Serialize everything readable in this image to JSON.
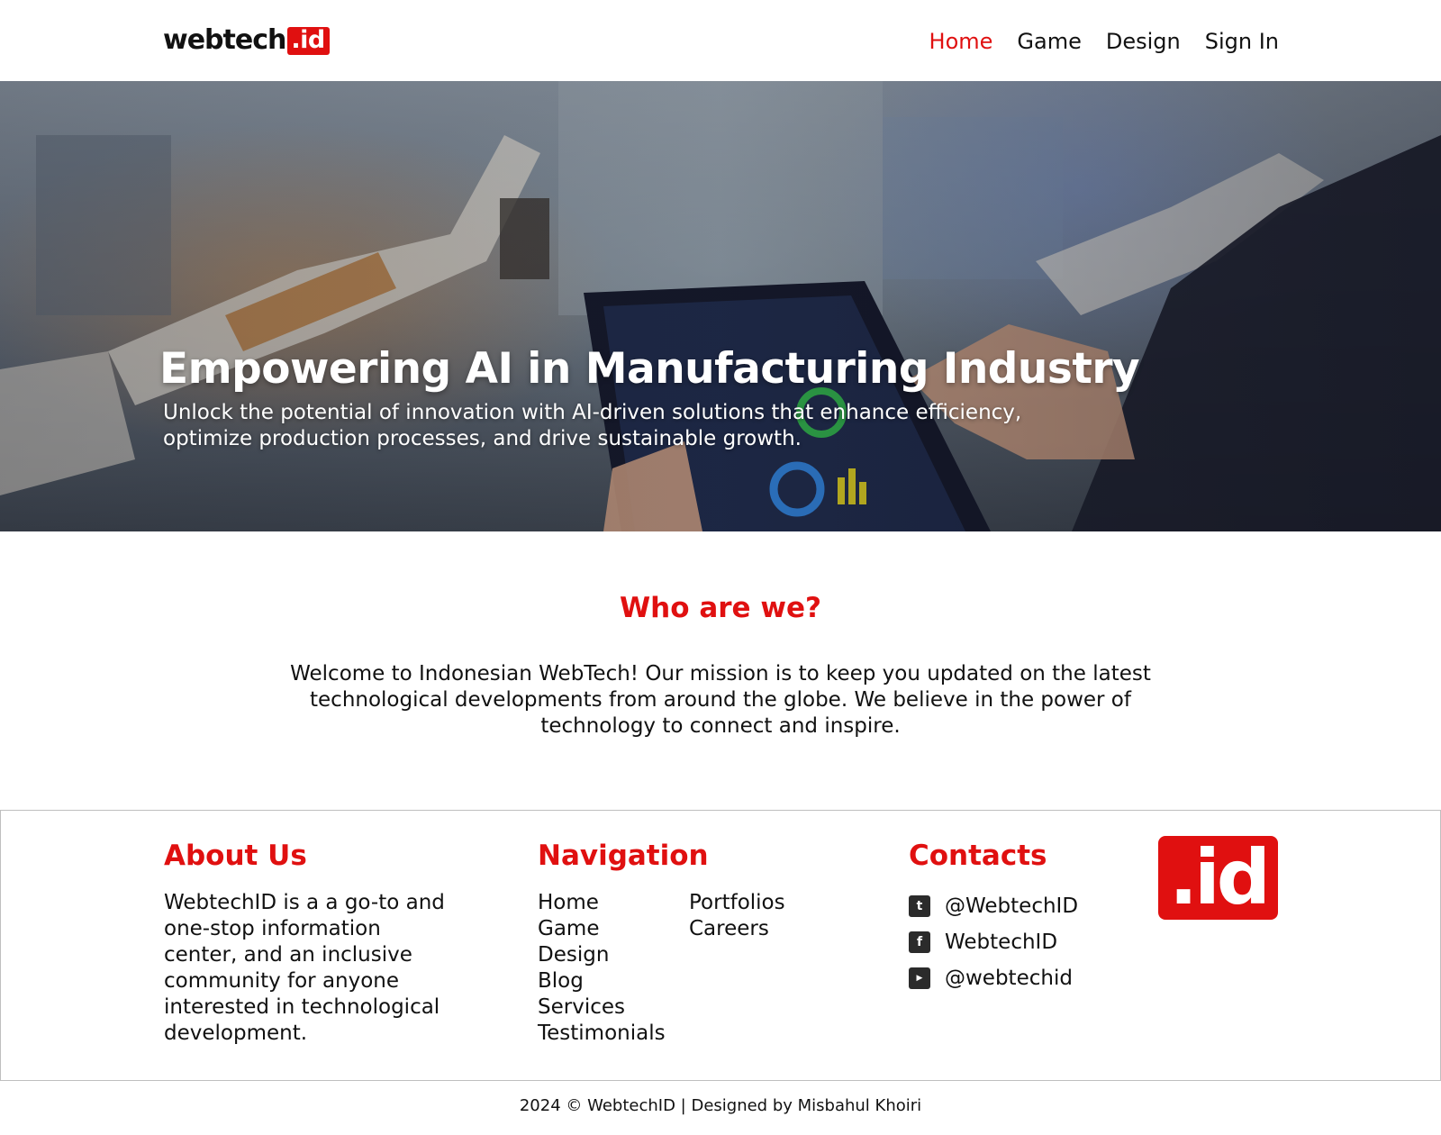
{
  "header": {
    "logo_text": "webtech",
    "logo_badge": ".id",
    "nav": [
      {
        "label": "Home",
        "active": true
      },
      {
        "label": "Game",
        "active": false
      },
      {
        "label": "Design",
        "active": false
      },
      {
        "label": "Sign In",
        "active": false
      }
    ]
  },
  "hero": {
    "title": "Empowering AI in Manufacturing Industry",
    "subtitle": "Unlock the potential of innovation with AI-driven solutions that enhance efficiency, optimize production processes, and drive sustainable growth."
  },
  "about": {
    "title": "Who are we?",
    "text": "Welcome to Indonesian WebTech! Our mission is to keep you updated on the latest technological developments from around the globe. We believe in the power of technology to connect and inspire."
  },
  "footer": {
    "about_title": "About Us",
    "about_text": "WebtechID is a a go-to and one-stop information center, and an inclusive community for anyone interested in technological development.",
    "navigation_title": "Navigation",
    "navigation_col1": [
      "Home",
      "Game",
      "Design",
      "Blog",
      "Services",
      "Testimonials"
    ],
    "navigation_col2": [
      "Portfolios",
      "Careers"
    ],
    "contacts_title": "Contacts",
    "contacts": [
      {
        "icon": "twitter-icon",
        "label": "@WebtechID"
      },
      {
        "icon": "facebook-icon",
        "label": "WebtechID"
      },
      {
        "icon": "youtube-icon",
        "label": "@webtechid"
      }
    ],
    "logo_mark": ".id"
  },
  "copyright": "2024 © WebtechID | Designed by Misbahul Khoiri",
  "colors": {
    "accent": "#e01010",
    "text": "#111111",
    "border": "#bfbfbf"
  }
}
